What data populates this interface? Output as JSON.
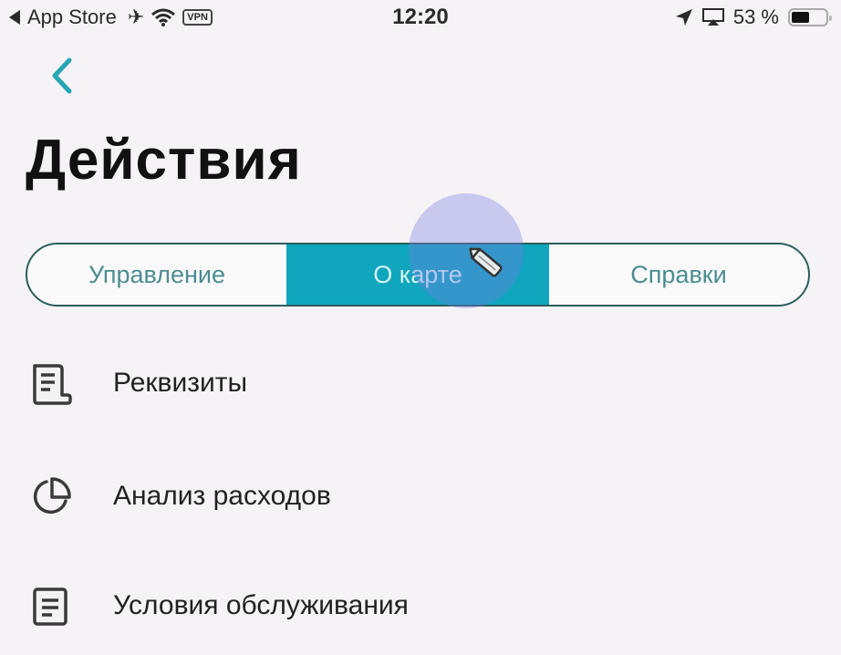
{
  "status_bar": {
    "back_app": "App Store",
    "vpn": "VPN",
    "time": "12:20",
    "battery_percent_text": "53 %",
    "battery_level": 0.53
  },
  "header": {
    "back_icon": "chevron-left-icon",
    "title": "Действия"
  },
  "tabs": [
    {
      "label": "Управление",
      "active": false
    },
    {
      "label": "О карте",
      "active": true
    },
    {
      "label": "Справки",
      "active": false
    }
  ],
  "menu": [
    {
      "icon": "document-scroll-icon",
      "label": "Реквизиты"
    },
    {
      "icon": "pie-chart-icon",
      "label": "Анализ расходов"
    },
    {
      "icon": "document-lines-icon",
      "label": "Условия обслуживания"
    }
  ],
  "colors": {
    "accent": "#10a6bd",
    "accent_text": "#4b8c91",
    "background": "#f5f3f5"
  }
}
